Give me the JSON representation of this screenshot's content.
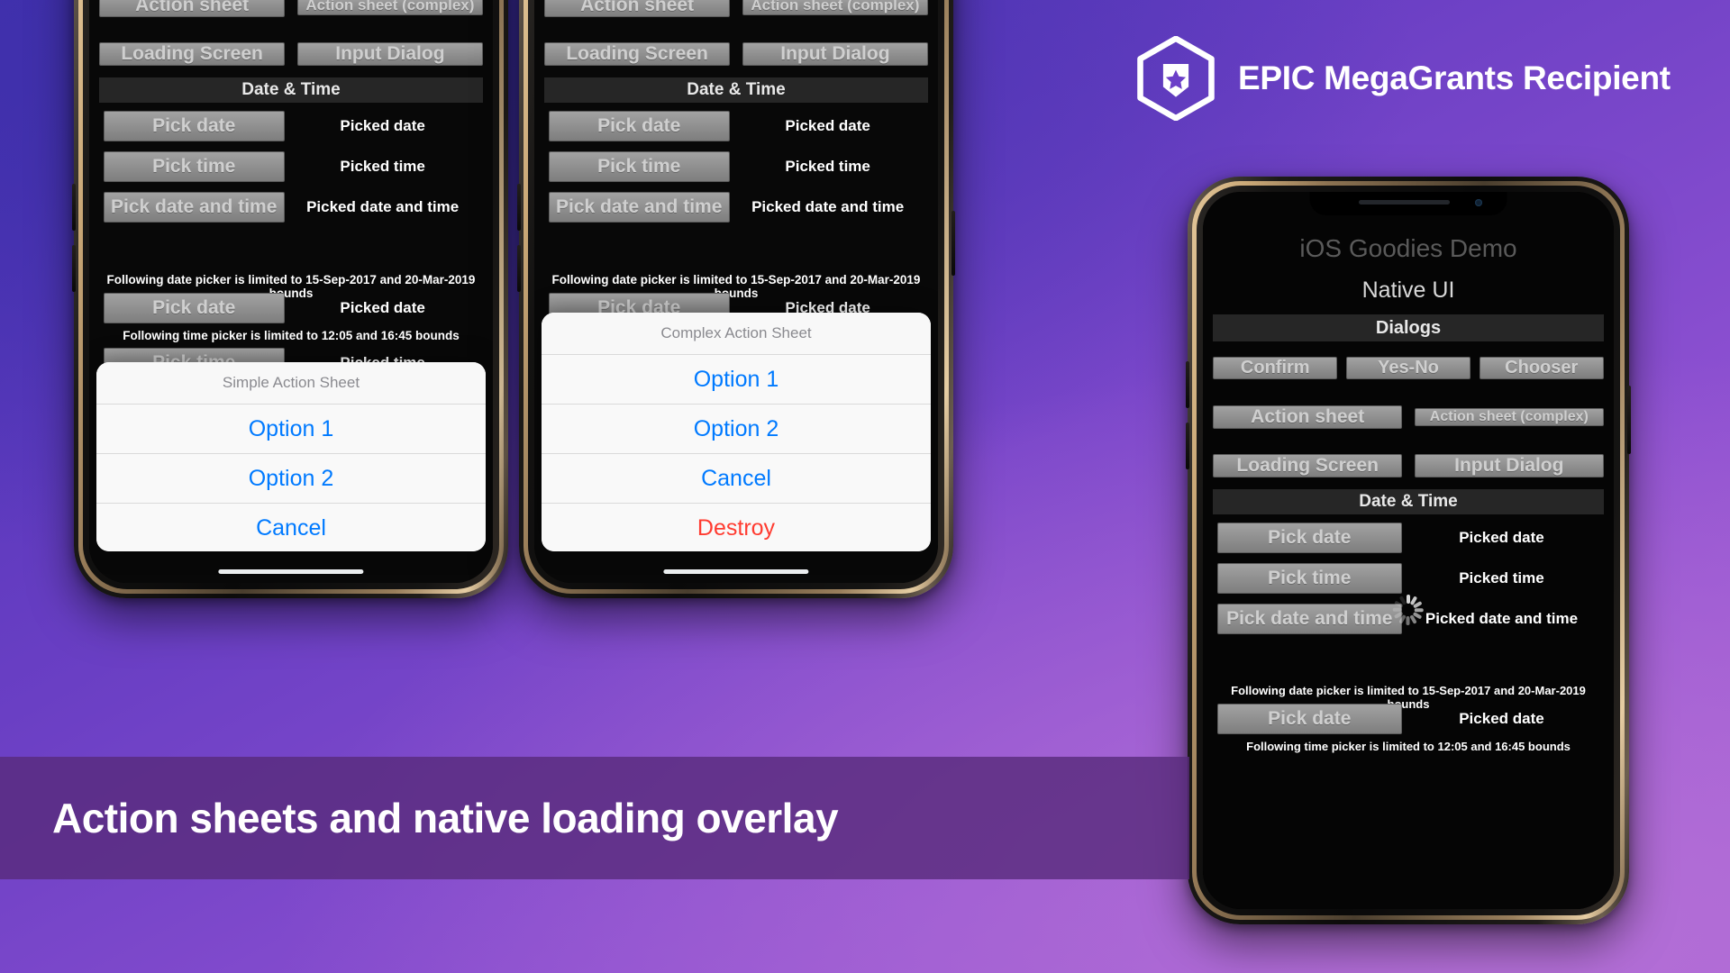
{
  "background": {
    "gradient_from": "#4731b4",
    "gradient_to": "#a95fd6"
  },
  "banner": {
    "text": "Action sheets and native loading overlay",
    "background_color": "#582a7a",
    "text_color": "#ffffff"
  },
  "epic_badge": {
    "label": "EPIC MegaGrants Recipient",
    "logo_icon": "epic-megagrants-shield-hexagon-icon",
    "text_color": "#ffffff"
  },
  "app": {
    "title": "iOS Goodies Demo",
    "section_native_ui": "Native UI",
    "dialogs_header": "Dialogs",
    "datetime_header": "Date & Time",
    "dialog_buttons_row1": [
      "Confirm",
      "Yes-No",
      "Chooser"
    ],
    "dialog_buttons_row2": [
      "Action sheet",
      "Action sheet (complex)"
    ],
    "dialog_buttons_row3": [
      "Loading Screen",
      "Input Dialog"
    ],
    "datetime_rows": [
      {
        "button": "Pick date",
        "label": "Picked date"
      },
      {
        "button": "Pick time",
        "label": "Picked time"
      },
      {
        "button": "Pick date and time",
        "label": "Picked date and time"
      }
    ],
    "note_date_bounds": "Following date picker is limited to 15-Sep-2017 and 20-Mar-2019 bounds",
    "bounded_date_row": {
      "button": "Pick date",
      "label": "Picked date"
    },
    "note_time_bounds": "Following time picker is limited to 12:05 and 16:45 bounds",
    "bounded_time_row": {
      "button": "Pick time",
      "label": "Picked time"
    }
  },
  "action_sheets": {
    "simple": {
      "title": "Simple Action Sheet",
      "items": [
        {
          "label": "Option 1",
          "style": "default"
        },
        {
          "label": "Option 2",
          "style": "default"
        },
        {
          "label": "Cancel",
          "style": "default"
        }
      ]
    },
    "complex": {
      "title": "Complex Action Sheet",
      "items": [
        {
          "label": "Option 1",
          "style": "default"
        },
        {
          "label": "Option 2",
          "style": "default"
        },
        {
          "label": "Cancel",
          "style": "default"
        },
        {
          "label": "Destroy",
          "style": "destructive"
        }
      ]
    }
  },
  "colors": {
    "accent_blue": "#007aff",
    "destructive_red": "#ff3b30",
    "sheet_background": "#f7f7f7",
    "button_face": "#8e8e8e"
  }
}
